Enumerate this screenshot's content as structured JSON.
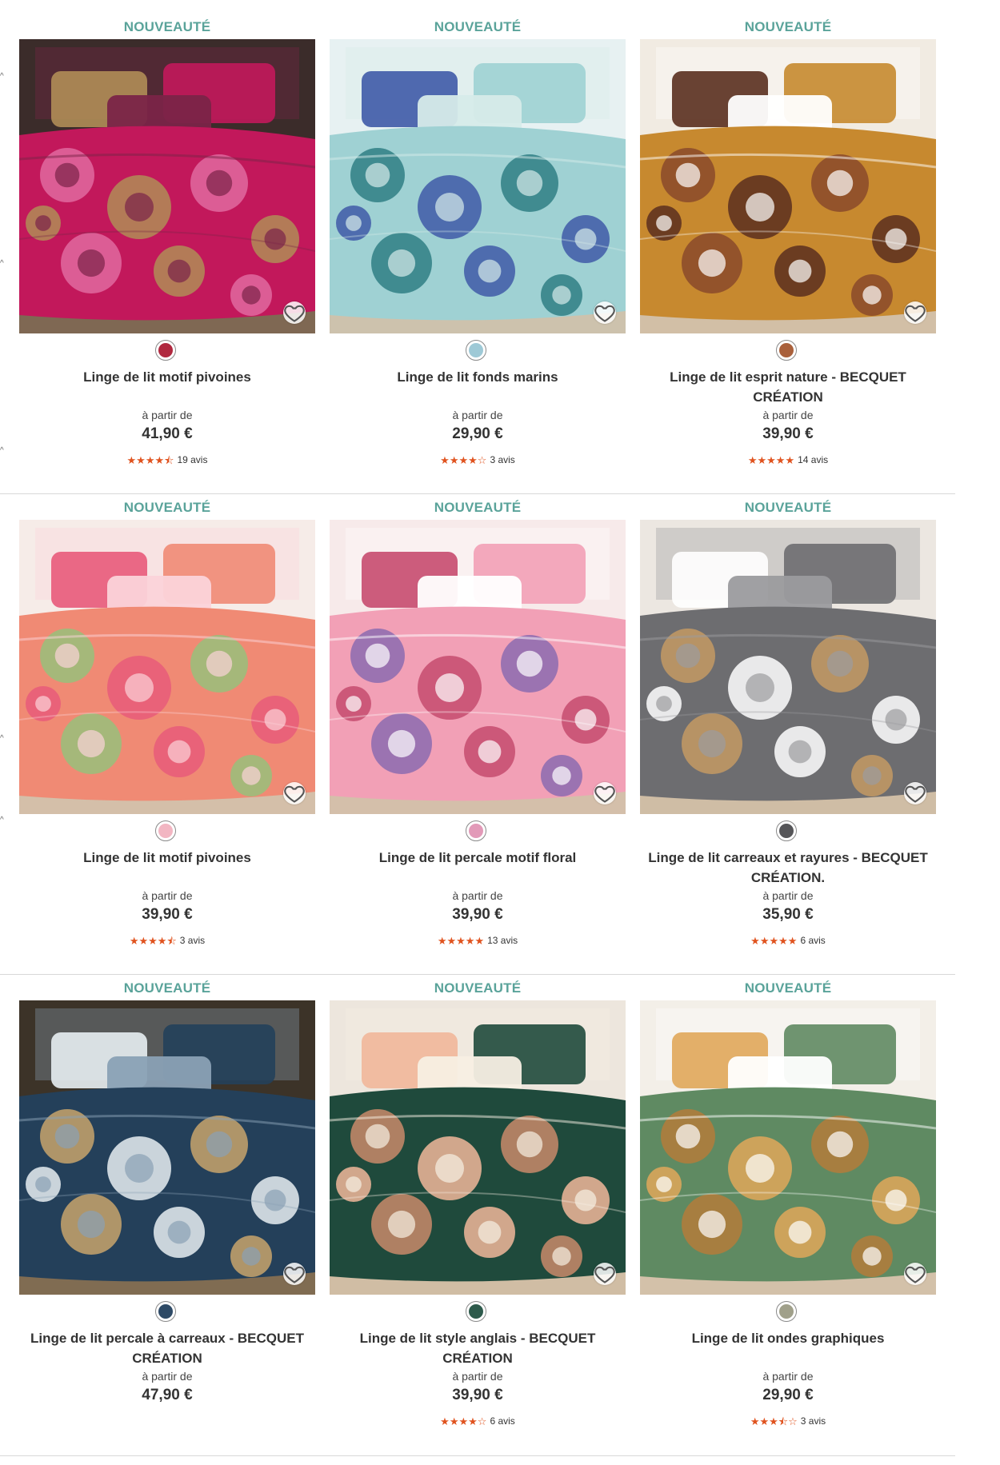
{
  "products": [
    {
      "badge": "NOUVEAUTÉ",
      "name": "Linge de lit motif pivoines",
      "from": "à partir de",
      "price": "41,90 €",
      "stars": "★★★★⯪",
      "reviews": "19 avis",
      "palette": {
        "bg": "#3b2c2a",
        "a": "#c2185b",
        "b": "#b08d57",
        "c": "#7a2448",
        "d": "#e06aa0"
      },
      "swatch": "#b0283f"
    },
    {
      "badge": "NOUVEAUTÉ",
      "name": "Linge de lit fonds marins",
      "from": "à partir de",
      "price": "29,90 €",
      "stars": "★★★★☆",
      "reviews": "3 avis",
      "palette": {
        "bg": "#e7f1f2",
        "a": "#9fd1d3",
        "b": "#3f5aa7",
        "c": "#d6ebe9",
        "d": "#2f7f84"
      },
      "swatch": "#9ec9d6"
    },
    {
      "badge": "NOUVEAUTÉ",
      "name": "Linge de lit esprit nature - BECQUET CRÉATION",
      "from": "à partir de",
      "price": "39,90 €",
      "stars": "★★★★★",
      "reviews": "14 avis",
      "palette": {
        "bg": "#f1ebe2",
        "a": "#c7892f",
        "b": "#5a2f1f",
        "c": "#ffffff",
        "d": "#8a4a2a"
      },
      "swatch": "#a9603b"
    },
    {
      "badge": "NOUVEAUTÉ",
      "name": "Linge de lit motif pivoines",
      "from": "à partir de",
      "price": "39,90 €",
      "stars": "★★★★⯪",
      "reviews": "3 avis",
      "palette": {
        "bg": "#f6ece8",
        "a": "#f08a74",
        "b": "#e85a7a",
        "c": "#fbd3d9",
        "d": "#98c07b"
      },
      "swatch": "#f2b6c2"
    },
    {
      "badge": "NOUVEAUTÉ",
      "name": "Linge de lit percale motif floral",
      "from": "à partir de",
      "price": "39,90 €",
      "stars": "★★★★★",
      "reviews": "13 avis",
      "palette": {
        "bg": "#f7eaea",
        "a": "#f2a0b6",
        "b": "#c64b6f",
        "c": "#ffffff",
        "d": "#8c6bb0"
      },
      "swatch": "#e29ab8"
    },
    {
      "badge": "NOUVEAUTÉ",
      "name": "Linge de lit carreaux et rayures - BECQUET CRÉATION.",
      "from": "à partir de",
      "price": "35,90 €",
      "stars": "★★★★★",
      "reviews": "6 avis",
      "palette": {
        "bg": "#ece7e1",
        "a": "#6d6d70",
        "b": "#ffffff",
        "c": "#9b9b9e",
        "d": "#c49a63"
      },
      "swatch": "#555558"
    },
    {
      "badge": "NOUVEAUTÉ",
      "name": "Linge de lit percale à carreaux - BECQUET CRÉATION",
      "from": "à partir de",
      "price": "47,90 €",
      "stars": "",
      "reviews": "",
      "palette": {
        "bg": "#3c3328",
        "a": "#24405a",
        "b": "#e8eef2",
        "c": "#8aa1b5",
        "d": "#c8a56c"
      },
      "swatch": "#2e4a66"
    },
    {
      "badge": "NOUVEAUTÉ",
      "name": "Linge de lit style anglais - BECQUET CRÉATION",
      "from": "à partir de",
      "price": "39,90 €",
      "stars": "★★★★☆",
      "reviews": "6 avis",
      "palette": {
        "bg": "#ede6dd",
        "a": "#1f4a3c",
        "b": "#f1b79a",
        "c": "#f7efe3",
        "d": "#c98a6a"
      },
      "swatch": "#2d5a4b"
    },
    {
      "badge": "NOUVEAUTÉ",
      "name": "Linge de lit ondes graphiques",
      "from": "à partir de",
      "price": "29,90 €",
      "stars": "★★★⯪☆",
      "reviews": "3 avis",
      "palette": {
        "bg": "#f3efe8",
        "a": "#5f8a62",
        "b": "#e0a75a",
        "c": "#ffffff",
        "d": "#b47b3b"
      },
      "swatch": "#a0a08a"
    }
  ],
  "icons": {
    "favorite": "heart-outline-icon",
    "swatch": "color-swatch",
    "rating": "star-rating"
  }
}
